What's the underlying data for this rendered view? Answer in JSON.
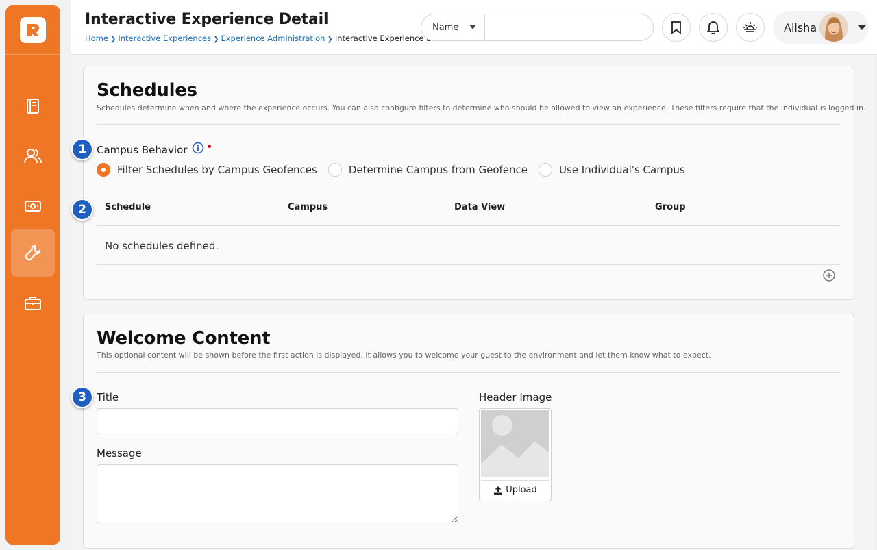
{
  "header": {
    "title": "Interactive Experience Detail",
    "breadcrumb": [
      "Home",
      "Interactive Experiences",
      "Experience Administration",
      "Interactive Experience Detail"
    ],
    "search_type": "Name",
    "search_value": "",
    "user_name": "Alisha"
  },
  "sidebar": {
    "logo_icon": "rock-logo-icon",
    "items": [
      {
        "icon": "book-icon",
        "active": false
      },
      {
        "icon": "people-icon",
        "active": false
      },
      {
        "icon": "money-icon",
        "active": false
      },
      {
        "icon": "wrench-icon",
        "active": true
      },
      {
        "icon": "briefcase-icon",
        "active": false
      }
    ]
  },
  "schedules": {
    "title": "Schedules",
    "description": "Schedules determine when and where the experience occurs. You can also configure filters to determine who should be allowed to view an experience. These filters require that the individual is logged in.",
    "campus_behavior_label": "Campus Behavior",
    "campus_options": [
      {
        "label": "Filter Schedules by Campus Geofences",
        "selected": true
      },
      {
        "label": "Determine Campus from Geofence",
        "selected": false
      },
      {
        "label": "Use Individual's Campus",
        "selected": false
      }
    ],
    "columns": [
      "Schedule",
      "Campus",
      "Data View",
      "Group"
    ],
    "empty_text": "No schedules defined."
  },
  "welcome": {
    "title": "Welcome Content",
    "description": "This optional content will be shown before the first action is displayed. It allows you to welcome your guest to the environment and let them know what to expect.",
    "title_label": "Title",
    "title_value": "",
    "message_label": "Message",
    "message_value": "",
    "header_image_label": "Header Image",
    "upload_label": "Upload"
  },
  "callouts": [
    "1",
    "2",
    "3"
  ],
  "colors": {
    "brand": "#ee7625",
    "link": "#1f6fb5",
    "badge": "#1f5fbf",
    "required": "#d0021b"
  }
}
